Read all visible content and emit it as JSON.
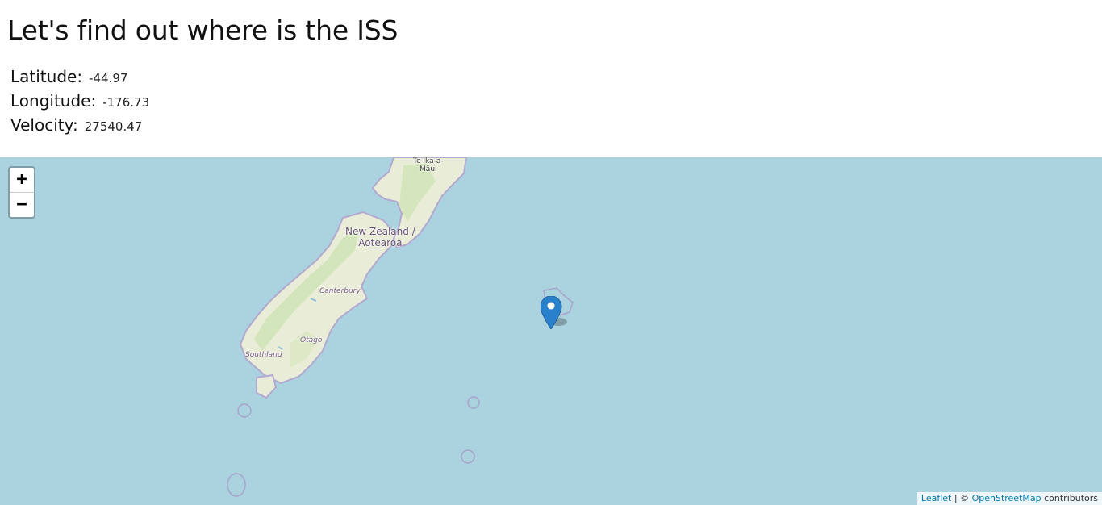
{
  "page": {
    "title": "Let's find out where is the ISS"
  },
  "stats": {
    "latitude_label": "Latitude:",
    "latitude_value": "-44.97",
    "longitude_label": "Longitude:",
    "longitude_value": "-176.73",
    "velocity_label": "Velocity:",
    "velocity_value": "27540.47"
  },
  "map": {
    "zoom_in": "+",
    "zoom_out": "−",
    "labels": {
      "country_line1": "New Zealand /",
      "country_line2": "Aotearoa",
      "city_line1": "Te Ika-a-",
      "city_line2": "Māui",
      "canterbury": "Canterbury",
      "otago": "Otago",
      "southland": "Southland"
    },
    "attribution": {
      "leaflet": "Leaflet",
      "separator": " | © ",
      "osm": "OpenStreetMap",
      "suffix": " contributors"
    },
    "marker_icon": "map-pin-icon",
    "colors": {
      "ocean": "#aad3df",
      "land": "#e8ecd6",
      "forest": "#cde3b4",
      "marker": "#2a81cb"
    }
  }
}
